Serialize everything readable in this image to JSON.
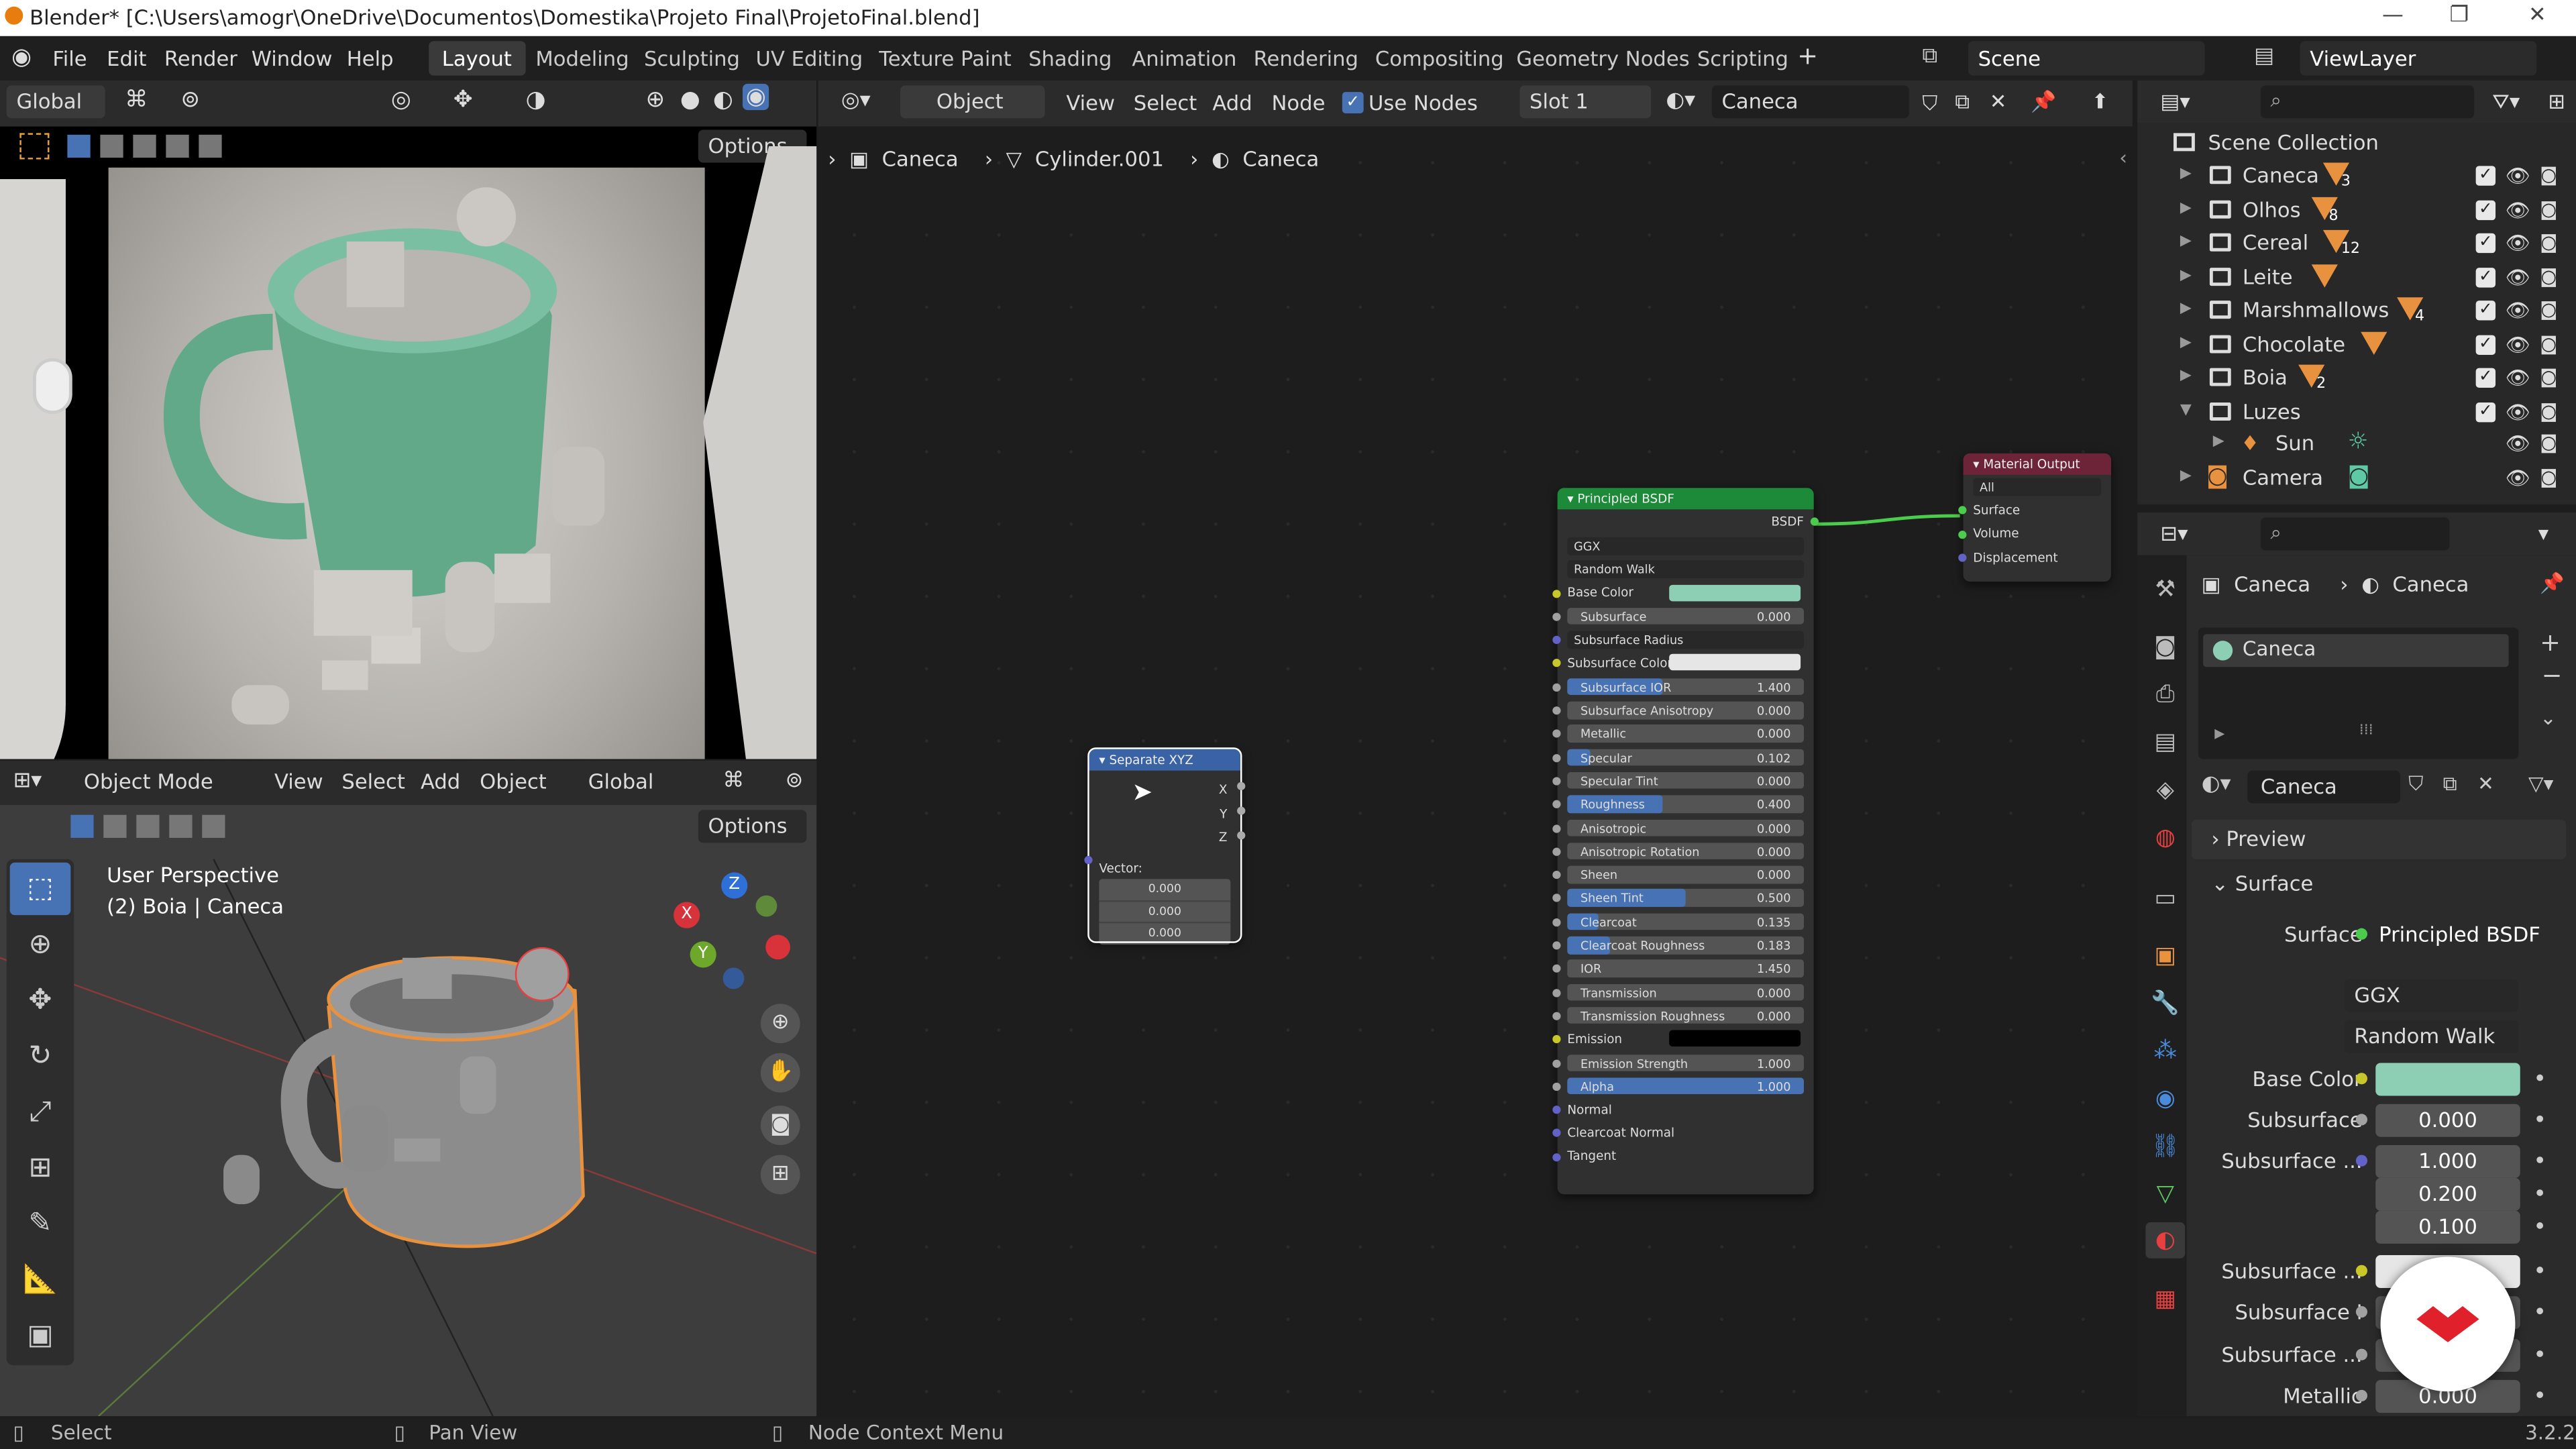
{
  "window": {
    "title": "Blender* [C:\\Users\\amogr\\OneDrive\\Documentos\\Domestika\\Projeto Final\\ProjetoFinal.blend]"
  },
  "menu": [
    "File",
    "Edit",
    "Render",
    "Window",
    "Help"
  ],
  "workspaces": [
    "Layout",
    "Modeling",
    "Sculpting",
    "UV Editing",
    "Texture Paint",
    "Shading",
    "Animation",
    "Rendering",
    "Compositing",
    "Geometry Nodes",
    "Scripting"
  ],
  "active_workspace": "Layout",
  "scene": "Scene",
  "view_layer": "ViewLayer",
  "render_view": {
    "transform": "Global",
    "options": "Options"
  },
  "viewport3d": {
    "mode": "Object Mode",
    "menus": [
      "View",
      "Select",
      "Add",
      "Object"
    ],
    "transform": "Global",
    "options": "Options",
    "info_line1": "User Perspective",
    "info_line2": "(2) Boia | Caneca",
    "gizmo": {
      "x": "X",
      "y": "Y",
      "z": "Z"
    }
  },
  "node_header": {
    "type": "Object",
    "menus": [
      "View",
      "Select",
      "Add",
      "Node"
    ],
    "use_nodes": "Use Nodes",
    "slot": "Slot 1",
    "material": "Caneca"
  },
  "breadcrumb": [
    "Caneca",
    "Cylinder.001",
    "Caneca"
  ],
  "separate_xyz": {
    "title": "Separate XYZ",
    "outputs": [
      "X",
      "Y",
      "Z"
    ],
    "vector_label": "Vector:",
    "values": [
      "0.000",
      "0.000",
      "0.000"
    ]
  },
  "material_output": {
    "title": "Material Output",
    "target": "All",
    "inputs": [
      "Surface",
      "Volume",
      "Displacement"
    ]
  },
  "principled": {
    "title": "Principled BSDF",
    "output": "BSDF",
    "distribution": "GGX",
    "subsurface_method": "Random Walk",
    "base_color_label": "Base Color",
    "base_color": "#8ccfb4",
    "subsurface_radius": "Subsurface Radius",
    "subsurface_color_label": "Subsurface Color",
    "fields": [
      {
        "label": "Subsurface",
        "value": "0.000",
        "fill": 0
      },
      {
        "label": "_radius"
      },
      {
        "label": "_ssscolor"
      },
      {
        "label": "Subsurface IOR",
        "value": "1.400",
        "fill": 0.4
      },
      {
        "label": "Subsurface Anisotropy",
        "value": "0.000",
        "fill": 0
      },
      {
        "label": "Metallic",
        "value": "0.000",
        "fill": 0
      },
      {
        "label": "Specular",
        "value": "0.102",
        "fill": 0.1
      },
      {
        "label": "Specular Tint",
        "value": "0.000",
        "fill": 0
      },
      {
        "label": "Roughness",
        "value": "0.400",
        "fill": 0.4
      },
      {
        "label": "Anisotropic",
        "value": "0.000",
        "fill": 0
      },
      {
        "label": "Anisotropic Rotation",
        "value": "0.000",
        "fill": 0
      },
      {
        "label": "Sheen",
        "value": "0.000",
        "fill": 0
      },
      {
        "label": "Sheen Tint",
        "value": "0.500",
        "fill": 0.5
      },
      {
        "label": "Clearcoat",
        "value": "0.135",
        "fill": 0.135
      },
      {
        "label": "Clearcoat Roughness",
        "value": "0.183",
        "fill": 0.183
      },
      {
        "label": "IOR",
        "value": "1.450",
        "fill": 0
      },
      {
        "label": "Transmission",
        "value": "0.000",
        "fill": 0
      },
      {
        "label": "Transmission Roughness",
        "value": "0.000",
        "fill": 0
      },
      {
        "label": "_emission"
      },
      {
        "label": "Emission Strength",
        "value": "1.000",
        "fill": 0
      },
      {
        "label": "Alpha",
        "value": "1.000",
        "fill": 1
      }
    ],
    "emission_label": "Emission",
    "vectors": [
      "Normal",
      "Clearcoat Normal",
      "Tangent"
    ]
  },
  "outliner": {
    "title": "Scene Collection",
    "items": [
      {
        "name": "Caneca",
        "count": "3"
      },
      {
        "name": "Olhos",
        "count": "8"
      },
      {
        "name": "Cereal",
        "count": "12"
      },
      {
        "name": "Leite",
        "count": ""
      },
      {
        "name": "Marshmallows",
        "count": "4"
      },
      {
        "name": "Chocolate",
        "count": ""
      },
      {
        "name": "Boia",
        "count": "2"
      },
      {
        "name": "Luzes",
        "count": ""
      }
    ],
    "sun": "Sun",
    "camera": "Camera"
  },
  "properties": {
    "breadcrumb": [
      "Caneca",
      "Caneca"
    ],
    "slot": "Caneca",
    "material": "Caneca",
    "preview": "Preview",
    "surface_panel": "Surface",
    "surface_label": "Surface",
    "surface_value": "Principled BSDF",
    "distribution": "GGX",
    "subsurface_method": "Random Walk",
    "rows": [
      {
        "label": "Base Color",
        "value": ""
      },
      {
        "label": "Subsurface",
        "value": "0.000"
      },
      {
        "label": "Subsurface ...",
        "value": "1.000"
      },
      {
        "label": "",
        "value": "0.200"
      },
      {
        "label": "",
        "value": "0.100"
      },
      {
        "label": "Subsurface ...",
        "value": ""
      },
      {
        "label": "Subsurface I",
        "value": ""
      },
      {
        "label": "Subsurface ...",
        "value": ""
      },
      {
        "label": "Metallic",
        "value": "0.000"
      }
    ]
  },
  "status": {
    "select": "Select",
    "pan": "Pan View",
    "context": "Node Context Menu",
    "version": "3.2.2"
  }
}
